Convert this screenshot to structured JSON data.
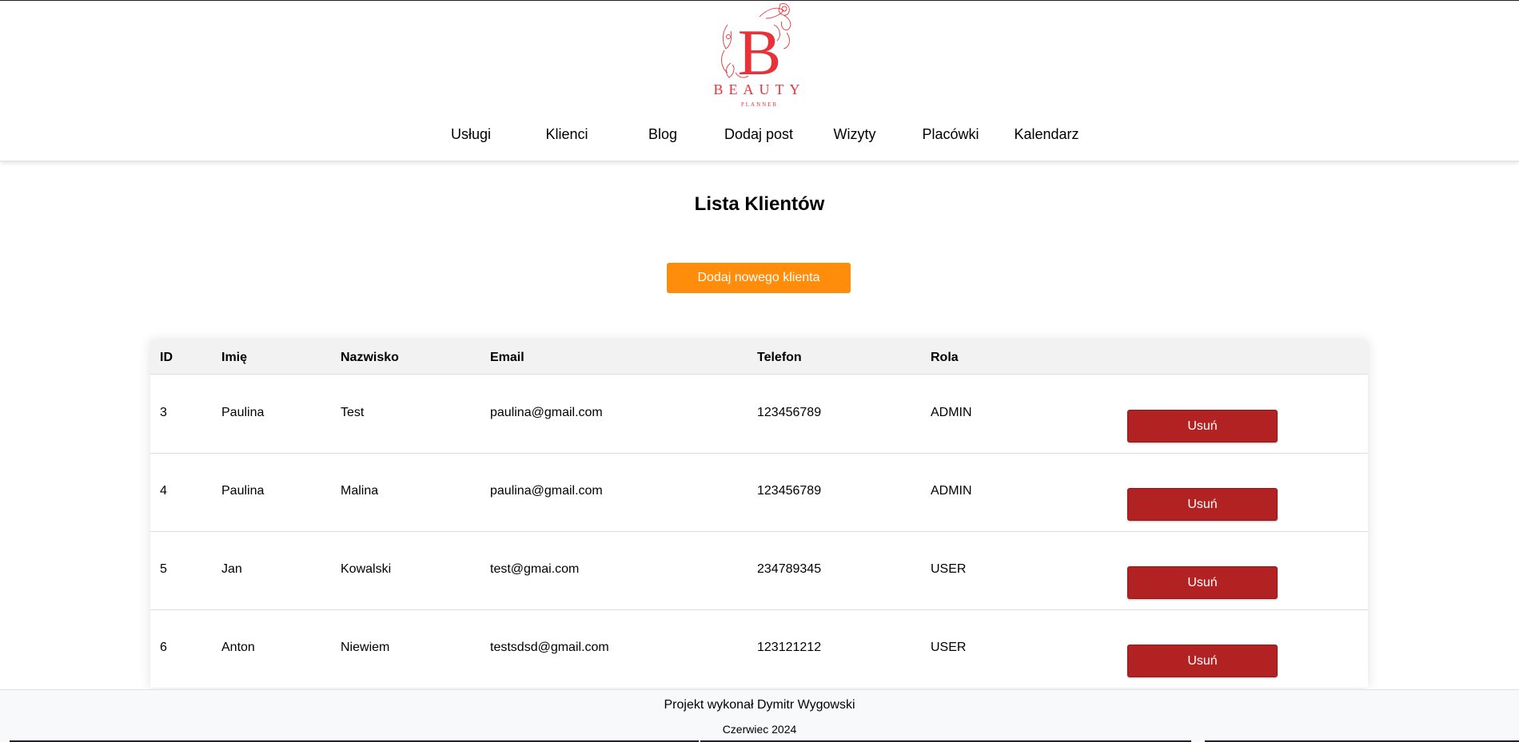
{
  "brand": {
    "logo_letter": "B",
    "logo_name": "BEAUTY",
    "logo_tagline": "PLANNER",
    "accent_color": "#e8323a"
  },
  "nav": {
    "items": [
      {
        "label": "Usługi"
      },
      {
        "label": "Klienci"
      },
      {
        "label": "Blog"
      },
      {
        "label": "Dodaj post"
      },
      {
        "label": "Wizyty"
      },
      {
        "label": "Placówki"
      },
      {
        "label": "Kalendarz"
      }
    ]
  },
  "main": {
    "title": "Lista Klientów",
    "add_button_label": "Dodaj nowego klienta",
    "add_button_color": "#ff8c0a"
  },
  "table": {
    "columns": [
      {
        "label": "ID"
      },
      {
        "label": "Imię"
      },
      {
        "label": "Nazwisko"
      },
      {
        "label": "Email"
      },
      {
        "label": "Telefon"
      },
      {
        "label": "Rola"
      }
    ],
    "rows": [
      {
        "id": "3",
        "first_name": "Paulina",
        "last_name": "Test",
        "email": "paulina@gmail.com",
        "phone": "123456789",
        "role": "ADMIN",
        "action_label": "Usuń"
      },
      {
        "id": "4",
        "first_name": "Paulina",
        "last_name": "Malina",
        "email": "paulina@gmail.com",
        "phone": "123456789",
        "role": "ADMIN",
        "action_label": "Usuń"
      },
      {
        "id": "5",
        "first_name": "Jan",
        "last_name": "Kowalski",
        "email": "test@gmai.com",
        "phone": "234789345",
        "role": "USER",
        "action_label": "Usuń"
      },
      {
        "id": "6",
        "first_name": "Anton",
        "last_name": "Niewiem",
        "email": "testsdsd@gmail.com",
        "phone": "123121212",
        "role": "USER",
        "action_label": "Usuń"
      }
    ],
    "delete_button_color": "#b22222"
  },
  "footer": {
    "author_line": "Projekt wykonał Dymitr Wygowski",
    "date_line": "Czerwiec 2024"
  }
}
